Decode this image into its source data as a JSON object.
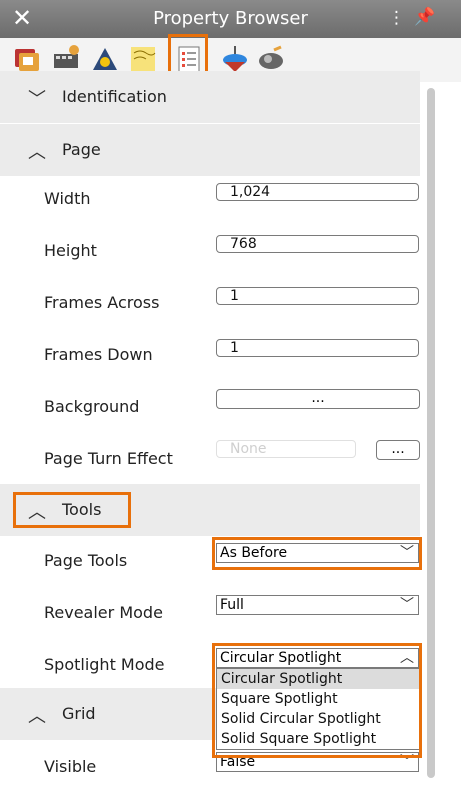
{
  "window": {
    "title": "Property Browser"
  },
  "toolbar": {
    "icons": [
      {
        "name": "page-properties-icon",
        "color": "#c0392b"
      },
      {
        "name": "media-icon",
        "color": "#8e44ad"
      },
      {
        "name": "tools-icon",
        "color": "#2c3e50"
      },
      {
        "name": "note-icon",
        "color": "#f1c40f"
      },
      {
        "name": "checklist-icon",
        "color": "#e74c3c"
      },
      {
        "name": "spinner-top-icon",
        "color": "#3498db"
      },
      {
        "name": "tuner-icon",
        "color": "#7f8c8d"
      }
    ],
    "active_index": 4
  },
  "sections": {
    "identification": {
      "label": "Identification",
      "collapsed": true
    },
    "page": {
      "label": "Page",
      "collapsed": false
    },
    "tools": {
      "label": "Tools",
      "collapsed": false
    },
    "grid": {
      "label": "Grid",
      "collapsed": false
    }
  },
  "page": {
    "width": {
      "label": "Width",
      "value": "1,024"
    },
    "height": {
      "label": "Height",
      "value": "768"
    },
    "frames_across": {
      "label": "Frames Across",
      "value": "1"
    },
    "frames_down": {
      "label": "Frames Down",
      "value": "1"
    },
    "background": {
      "label": "Background",
      "button": "..."
    },
    "page_turn": {
      "label": "Page Turn Effect",
      "value": "None",
      "button": "..."
    }
  },
  "tools": {
    "page_tools": {
      "label": "Page Tools",
      "value": "As Before"
    },
    "revealer_mode": {
      "label": "Revealer Mode",
      "value": "Full"
    },
    "spotlight_mode": {
      "label": "Spotlight Mode",
      "value": "Circular Spotlight",
      "options": [
        "Circular Spotlight",
        "Square Spotlight",
        "Solid Circular Spotlight",
        "Solid Square Spotlight"
      ]
    }
  },
  "grid": {
    "visible": {
      "label": "Visible",
      "value": "False"
    }
  },
  "highlight_color": "#e8700b"
}
